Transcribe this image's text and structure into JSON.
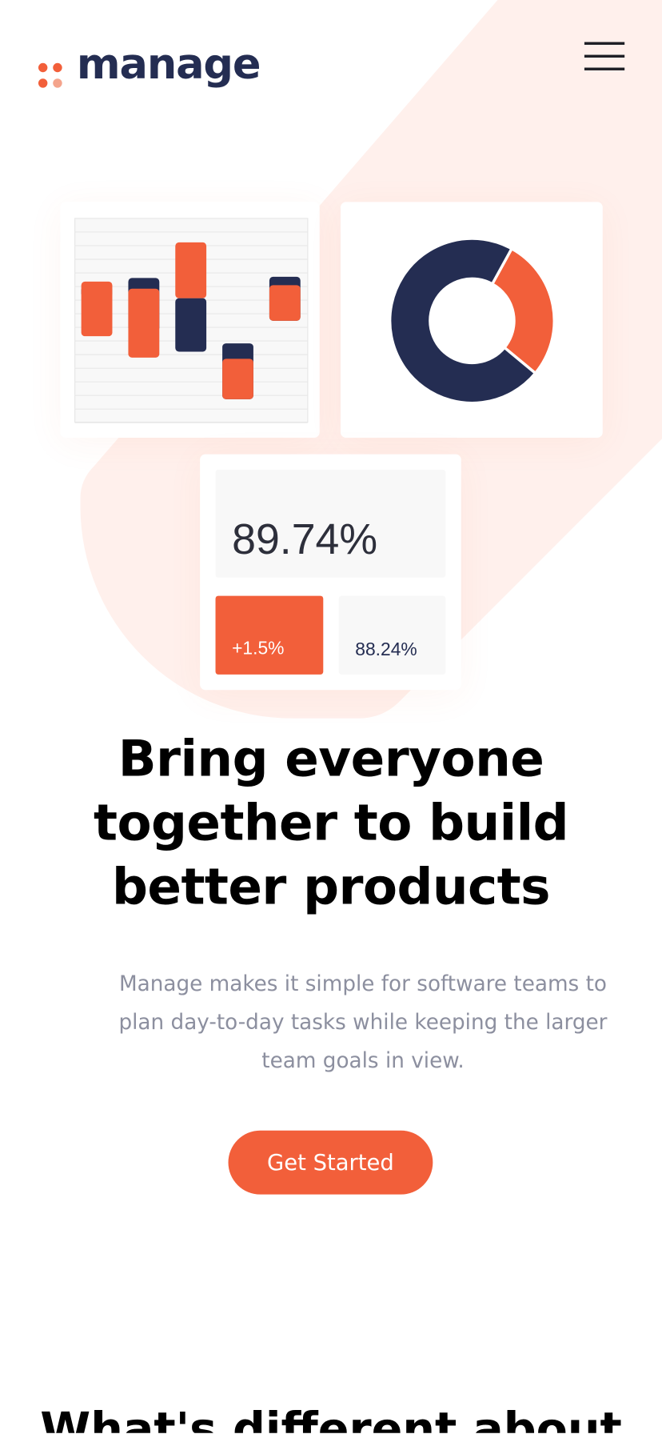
{
  "brand": {
    "name": "manage",
    "accent": "#f25f3a",
    "navy": "#242d52",
    "tint": "#fff0ec"
  },
  "nav": {
    "menu_icon": "hamburger-menu-icon"
  },
  "illustration": {
    "bar_chart": {
      "type": "bar",
      "series": [
        {
          "color": "#242d52",
          "values": [
            [
              1,
              1.45
            ],
            [
              -0.45,
              1.8
            ],
            [
              -1.3,
              0.95
            ],
            [
              -3.3,
              -0.95
            ],
            [
              0,
              1.85
            ]
          ]
        },
        {
          "color": "#f25f3a",
          "values": [
            [
              -0.65,
              1.65
            ],
            [
              -1.55,
              1.35
            ],
            [
              0.95,
              3.3
            ],
            [
              -1.6,
              -3.3
            ],
            [
              -0.0,
              1.5
            ]
          ]
        }
      ]
    },
    "donut": {
      "type": "pie",
      "slices": [
        {
          "value": 0.28,
          "color": "#f25f3a"
        },
        {
          "value": 0.72,
          "color": "#242d52"
        }
      ]
    },
    "stats": {
      "main": "89.74%",
      "change": "+1.5%",
      "secondary": "88.24%"
    }
  },
  "hero": {
    "title_lines": [
      "Bring everyone",
      "together to build",
      "better products"
    ],
    "description": "Manage makes it simple for software teams to plan day-to-day tasks while keeping the larger team goals in view.",
    "cta_label": "Get Started"
  },
  "next_section": {
    "title": "What's different about"
  }
}
